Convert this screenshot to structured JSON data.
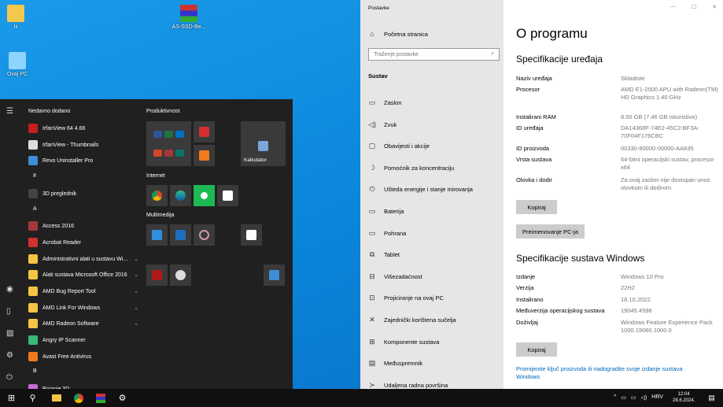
{
  "desktop": {
    "icons": [
      "Iii",
      "Ovaj PC",
      "AS-SSD-Be..."
    ]
  },
  "start": {
    "headers": {
      "recent": "Nedavno dodano",
      "prod": "Produktivnost",
      "internet": "Internet",
      "multi": "Multimedija"
    },
    "items": [
      {
        "label": "IrfanView 64 4.66",
        "color": "#c41e1e"
      },
      {
        "label": "IrfanView - Thumbnails",
        "color": "#ddd"
      },
      {
        "label": "Revo Uninstaller Pro",
        "color": "#3b8fd6"
      },
      {
        "label": "#",
        "letter": true
      },
      {
        "label": "3D preglednik",
        "color": "#444"
      },
      {
        "label": "A",
        "letter": true
      },
      {
        "label": "Access 2016",
        "color": "#a4373a"
      },
      {
        "label": "Acrobat Reader",
        "color": "#d32f2f"
      },
      {
        "label": "Administrativni alati u sustavu Wi...",
        "color": "#f4c542",
        "chev": true
      },
      {
        "label": "Alati sustava Microsoft Office 2016",
        "color": "#f4c542",
        "chev": true
      },
      {
        "label": "AMD Bug Report Tool",
        "color": "#f4c542",
        "chev": true
      },
      {
        "label": "AMD Link For Windows",
        "color": "#f4c542",
        "chev": true
      },
      {
        "label": "AMD Radeon Software",
        "color": "#f4c542",
        "chev": true
      },
      {
        "label": "Angry IP Scanner",
        "color": "#3ab77a"
      },
      {
        "label": "Avast Free Antivirus",
        "color": "#f07a1c"
      },
      {
        "label": "B",
        "letter": true
      },
      {
        "label": "Bojanje 3D",
        "color": "#c86dd7"
      }
    ],
    "calc": "Kalkulator"
  },
  "settings": {
    "title": "Postavke",
    "home": "Početna stranica",
    "search_placeholder": "Traženje postavke",
    "section": "Sustav",
    "nav": [
      {
        "icon": "▭",
        "label": "Zaslon"
      },
      {
        "icon": "◁)",
        "label": "Zvuk"
      },
      {
        "icon": "▢",
        "label": "Obavijesti i akcije"
      },
      {
        "icon": "☽",
        "label": "Pomoćnik za koncentraciju"
      },
      {
        "icon": "⏻",
        "label": "Ušteda energije i stanje mirovanja"
      },
      {
        "icon": "▭",
        "label": "Baterija"
      },
      {
        "icon": "▭",
        "label": "Pohrana"
      },
      {
        "icon": "⧉",
        "label": "Tablet"
      },
      {
        "icon": "⊟",
        "label": "Višezadaćnost"
      },
      {
        "icon": "⊡",
        "label": "Projiciranje na ovaj PC"
      },
      {
        "icon": "✕",
        "label": "Zajednički korištena sučelja"
      },
      {
        "icon": "⊞",
        "label": "Komponente sustava"
      },
      {
        "icon": "▤",
        "label": "Međuspremnik"
      },
      {
        "icon": "≻",
        "label": "Udaljena radna površina"
      }
    ],
    "page_title": "O programu",
    "device_title": "Specifikacije uređaja",
    "device": [
      {
        "k": "Naziv uređaja",
        "v": "Skladiste"
      },
      {
        "k": "Procesor",
        "v": "AMD E1-2500 APU with Radeon(TM) HD Graphics 1.40 GHz"
      },
      {
        "k": "Instalirani RAM",
        "v": "8.00 GB (7.46 GB iskoristivo)"
      },
      {
        "k": "ID uređaja",
        "v": "DA14368F-74E2-45C2-BF3A-70F04F176CBC"
      },
      {
        "k": "ID proizvoda",
        "v": "00330-80000-00000-AA835"
      },
      {
        "k": "Vrsta sustava",
        "v": "64-bitni operacijski sustav, procesor x64"
      },
      {
        "k": "Olovka i dodir",
        "v": "Za ovaj zaslon nije dostupan unos olovkom ili dodirom"
      }
    ],
    "copy": "Kopiraj",
    "rename": "Preimenovanje PC-ja",
    "win_title": "Specifikacije sustava Windows",
    "win": [
      {
        "k": "Izdanje",
        "v": "Windows 10 Pro"
      },
      {
        "k": "Verzija",
        "v": "22H2"
      },
      {
        "k": "Instalirano",
        "v": "18.10.2022."
      },
      {
        "k": "Međuverzija operacijskog sustava",
        "v": "19045.4598"
      },
      {
        "k": "Doživljaj",
        "v": "Windows Feature Experience Pack 1000.19060.1000.0"
      }
    ],
    "link": "Promijenite ključ proizvoda ili nadogradite svoje izdanje sustava Windows",
    "controls": {
      "min": "—",
      "max": "☐",
      "close": "✕"
    }
  },
  "taskbar": {
    "lang": "HRV",
    "time": "12:04",
    "date": "28.6.2024."
  }
}
